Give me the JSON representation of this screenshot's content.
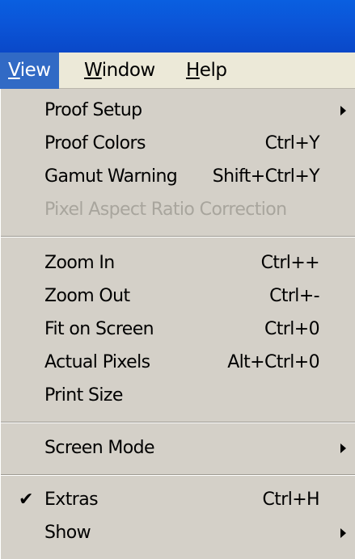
{
  "menubar": {
    "items": [
      {
        "label_first": "V",
        "label_rest": "iew"
      },
      {
        "label_first": "W",
        "label_rest": "indow"
      },
      {
        "label_first": "H",
        "label_rest": "elp"
      }
    ]
  },
  "menu": {
    "items": [
      {
        "label": "Proof Setup",
        "shortcut": "",
        "submenu": true
      },
      {
        "label": "Proof Colors",
        "shortcut": "Ctrl+Y"
      },
      {
        "label": "Gamut Warning",
        "shortcut": "Shift+Ctrl+Y"
      },
      {
        "label": "Pixel Aspect Ratio Correction",
        "shortcut": "",
        "disabled": true
      },
      {
        "label": "Zoom In",
        "shortcut": "Ctrl++"
      },
      {
        "label": "Zoom Out",
        "shortcut": "Ctrl+-"
      },
      {
        "label": "Fit on Screen",
        "shortcut": "Ctrl+0"
      },
      {
        "label": "Actual Pixels",
        "shortcut": "Alt+Ctrl+0"
      },
      {
        "label": "Print Size",
        "shortcut": ""
      },
      {
        "label": "Screen Mode",
        "shortcut": "",
        "submenu": true
      },
      {
        "label": "Extras",
        "shortcut": "Ctrl+H",
        "checked": true,
        "check_mark": "✔"
      },
      {
        "label": "Show",
        "shortcut": "",
        "submenu": true
      }
    ]
  },
  "colors": {
    "title_bar": "#0b55d8",
    "menubar_bg": "#ece9d8",
    "highlight": "#316ac5",
    "menu_bg": "#d4d0c8",
    "disabled_text": "#a8a59d"
  }
}
